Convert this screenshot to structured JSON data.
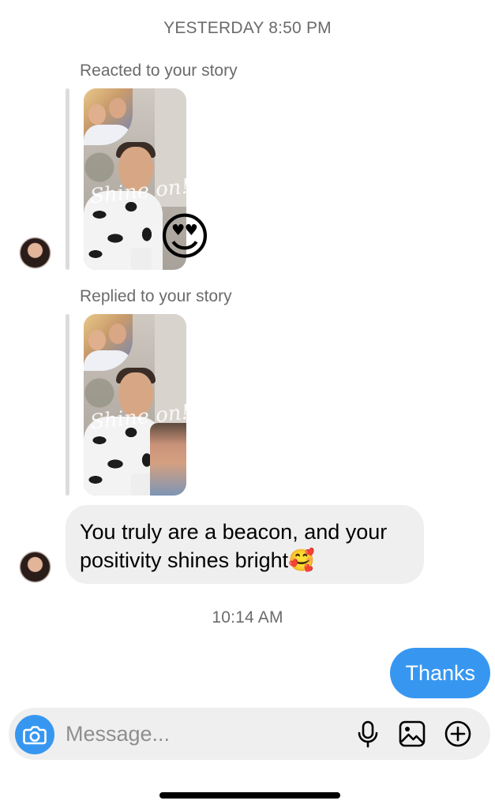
{
  "timestamps": {
    "first": "YESTERDAY 8:50 PM",
    "second": "10:14 AM"
  },
  "story_reaction": {
    "caption": "Reacted to your story",
    "sticker_text": "Shine on!",
    "reaction": "😍"
  },
  "story_reply": {
    "caption": "Replied to your story",
    "sticker_text": "Shine on!"
  },
  "incoming_message": {
    "text": "You truly are a beacon, and your positivity shines bright🥰"
  },
  "outgoing_message": {
    "text": "Thanks"
  },
  "composer": {
    "placeholder": "Message..."
  },
  "icons": {
    "camera": "camera-icon",
    "microphone": "microphone-icon",
    "gallery": "image-icon",
    "more": "plus-circle-icon"
  },
  "colors": {
    "accent": "#3797f0",
    "incoming_bubble": "#efefef",
    "meta_text": "#6b6b6b"
  }
}
